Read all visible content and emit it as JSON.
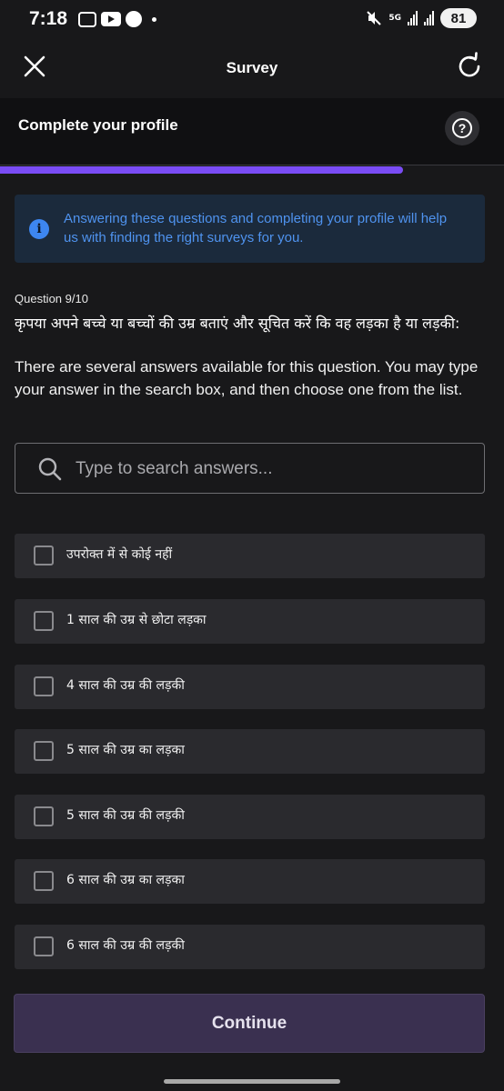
{
  "status_bar": {
    "time": "7:18",
    "network": "5G",
    "battery": "81",
    "icons": [
      "screen-record-icon",
      "youtube-icon",
      "app-icon",
      "notification-dot-icon",
      "mute-icon",
      "signal-icon",
      "battery-icon"
    ]
  },
  "header": {
    "title": "Survey",
    "close_icon": "close-icon",
    "refresh_icon": "refresh-icon"
  },
  "profile": {
    "title": "Complete your profile",
    "help_glyph": "?",
    "progress_fraction": 0.8,
    "progress_color": "#7a4cf5"
  },
  "info": {
    "icon_glyph": "i",
    "text": "Answering these questions and completing your profile will help us with finding the right surveys for you."
  },
  "question": {
    "number": "Question 9/10",
    "text": "कृपया अपने बच्चे या बच्चों की उम्र बताएं और सूचित करें कि वह लड़का है या लड़की:",
    "help": "There are several answers available for this question. You may type your answer in the search box, and then choose one from the list."
  },
  "search": {
    "placeholder": "Type to search answers...",
    "value": ""
  },
  "options": [
    "उपरोक्त में से कोई नहीं",
    "1 साल की उम्र से छोटा लड़का",
    "4 साल की उम्र की लड़की",
    "5 साल की उम्र का लड़का",
    "5 साल की उम्र की लड़की",
    "6 साल की उम्र का लड़का",
    "6 साल की उम्र की लड़की"
  ],
  "continue_label": "Continue",
  "colors": {
    "background": "#18181a",
    "accent": "#7a4cf5",
    "info_text": "#4f93ef",
    "info_bg": "#1b2a3c",
    "option_bg": "#2a2a2e",
    "button_bg": "#3a3050"
  }
}
